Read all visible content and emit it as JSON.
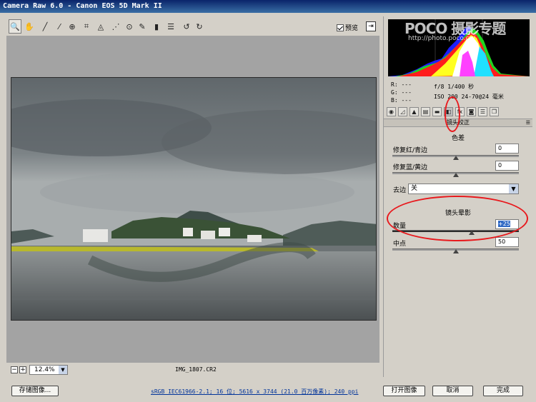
{
  "window": {
    "title": "Camera Raw 6.0 -  Canon EOS 5D Mark II"
  },
  "toolbar": {
    "tools": [
      {
        "name": "zoom-tool",
        "icon": "magnifier-icon",
        "glyph": "🔍"
      },
      {
        "name": "hand-tool",
        "icon": "hand-icon",
        "glyph": "✋"
      },
      {
        "name": "white-balance-tool",
        "icon": "eyedropper-icon",
        "glyph": "╱"
      },
      {
        "name": "color-sampler-tool",
        "icon": "color-sampler-icon",
        "glyph": "⁄"
      },
      {
        "name": "targeted-adjustment-tool",
        "icon": "target-icon",
        "glyph": "⊕"
      },
      {
        "name": "crop-tool",
        "icon": "crop-icon",
        "glyph": "⌗"
      },
      {
        "name": "straighten-tool",
        "icon": "straighten-icon",
        "glyph": "◬"
      },
      {
        "name": "spot-removal-tool",
        "icon": "spot-removal-icon",
        "glyph": "⋰"
      },
      {
        "name": "red-eye-tool",
        "icon": "red-eye-icon",
        "glyph": "⊙"
      },
      {
        "name": "adjustment-brush-tool",
        "icon": "brush-icon",
        "glyph": "✎"
      },
      {
        "name": "graduated-filter-tool",
        "icon": "gradient-icon",
        "glyph": "▮"
      },
      {
        "name": "preferences-tool",
        "icon": "list-icon",
        "glyph": "☰"
      },
      {
        "name": "rotate-left-tool",
        "icon": "rotate-ccw-icon",
        "glyph": "↺"
      },
      {
        "name": "rotate-right-tool",
        "icon": "rotate-cw-icon",
        "glyph": "↻"
      }
    ],
    "preview_label": "预览",
    "fullscreen_glyph": "⇥"
  },
  "watermark": {
    "brand": "POCO 摄影专题",
    "url": "http://photo.poco.cn/"
  },
  "readout": {
    "r": "R:  ---",
    "g": "G:  ---",
    "b": "B:  ---"
  },
  "exif": {
    "line1": "f/8   1/400 秒",
    "line2": "ISO 200  24-70@24 毫米"
  },
  "panel_tabs": [
    {
      "name": "tab-basic",
      "glyph": "◉"
    },
    {
      "name": "tab-tone-curve",
      "glyph": "◿"
    },
    {
      "name": "tab-detail",
      "glyph": "▲"
    },
    {
      "name": "tab-hsl",
      "glyph": "▤"
    },
    {
      "name": "tab-split-toning",
      "glyph": "▬"
    },
    {
      "name": "tab-lens-corrections",
      "glyph": "◧"
    },
    {
      "name": "tab-effects",
      "glyph": "fx"
    },
    {
      "name": "tab-camera-calibration",
      "glyph": "◙"
    },
    {
      "name": "tab-presets",
      "glyph": "☰"
    },
    {
      "name": "tab-snapshots",
      "glyph": "❐"
    }
  ],
  "lens_panel": {
    "section_title": "镜头校正",
    "chromatic": {
      "title": "色差",
      "red_cyan_label": "修复红/青边",
      "red_cyan_value": "0",
      "red_cyan_position": 0.5,
      "blue_yellow_label": "修复蓝/黄边",
      "blue_yellow_value": "0",
      "blue_yellow_position": 0.5,
      "defringe_label": "去边",
      "defringe_value": "关"
    },
    "vignetting": {
      "title": "镜头晕影",
      "amount_label": "数量",
      "amount_value": "+25",
      "amount_position": 0.625,
      "midpoint_label": "中点",
      "midpoint_value": "50",
      "midpoint_position": 0.5
    }
  },
  "status": {
    "zoom_minus": "−",
    "zoom_plus": "+",
    "zoom_value": "12.4%",
    "filename": "IMG_1807.CR2"
  },
  "footer": {
    "save_label": "存储图像...",
    "workflow_link": "sRGB IEC61966-2.1; 16 位; 5616 x 3744 (21.0 百万像素); 240 ppi",
    "open_label": "打开图像",
    "cancel_label": "取消",
    "done_label": "完成"
  },
  "colors": {
    "annotation": "#e8191d",
    "titlebar": "#0a246a",
    "link": "#00339a"
  }
}
